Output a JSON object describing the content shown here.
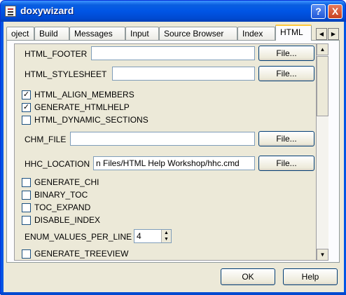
{
  "window": {
    "title": "doxywizard"
  },
  "titlebar_buttons": {
    "help": "?",
    "close": "X"
  },
  "tabs": [
    {
      "label": "oject"
    },
    {
      "label": "Build"
    },
    {
      "label": "Messages"
    },
    {
      "label": "Input"
    },
    {
      "label": "Source Browser"
    },
    {
      "label": "Index"
    },
    {
      "label": "HTML"
    }
  ],
  "active_tab": "HTML",
  "tab_scroll": {
    "left": "◀",
    "right": "▶"
  },
  "options": {
    "html_footer": {
      "label": "HTML_FOOTER",
      "value": "",
      "button": "File..."
    },
    "html_stylesheet": {
      "label": "HTML_STYLESHEET",
      "value": "",
      "button": "File..."
    },
    "html_align_members": {
      "label": "HTML_ALIGN_MEMBERS",
      "checked": true,
      "mark": "✓"
    },
    "generate_htmlhelp": {
      "label": "GENERATE_HTMLHELP",
      "checked": true,
      "mark": "✓"
    },
    "html_dynamic_sections": {
      "label": "HTML_DYNAMIC_SECTIONS",
      "checked": false,
      "mark": ""
    },
    "chm_file": {
      "label": "CHM_FILE",
      "value": "",
      "button": "File..."
    },
    "hhc_location": {
      "label": "HHC_LOCATION",
      "value": "n Files/HTML Help Workshop/hhc.cmd",
      "button": "File..."
    },
    "generate_chi": {
      "label": "GENERATE_CHI",
      "checked": false,
      "mark": ""
    },
    "binary_toc": {
      "label": "BINARY_TOC",
      "checked": false,
      "mark": ""
    },
    "toc_expand": {
      "label": "TOC_EXPAND",
      "checked": false,
      "mark": ""
    },
    "disable_index": {
      "label": "DISABLE_INDEX",
      "checked": false,
      "mark": ""
    },
    "enum_values_per_line": {
      "label": "ENUM_VALUES_PER_LINE",
      "value": "4"
    },
    "generate_treeview": {
      "label": "GENERATE_TREEVIEW",
      "checked": false,
      "mark": ""
    }
  },
  "scrollbar": {
    "up": "▲",
    "down": "▼"
  },
  "footer": {
    "ok": "OK",
    "help": "Help"
  },
  "colors": {
    "titlebar": "#0055e5",
    "client": "#ece9d8",
    "active_tab_accent": "#ffc83c"
  }
}
